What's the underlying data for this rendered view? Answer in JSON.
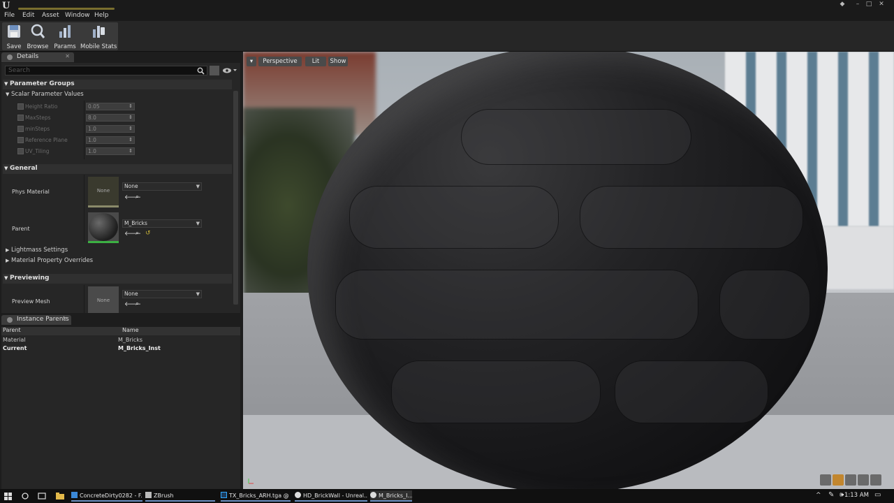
{
  "menu": [
    "File",
    "Edit",
    "Asset",
    "Window",
    "Help"
  ],
  "toolbar": {
    "buttons": [
      {
        "label": "Save",
        "icon": "save-icon"
      },
      {
        "label": "Browse",
        "icon": "browse-icon"
      },
      {
        "label": "Params",
        "icon": "params-icon"
      },
      {
        "label": "Mobile Stats",
        "icon": "mobile-stats-icon"
      }
    ]
  },
  "details": {
    "tab_label": "Details",
    "search_placeholder": "Search",
    "parameter_groups": "Parameter Groups",
    "scalar_parameter_values": "Scalar Parameter Values",
    "scalar_params": [
      {
        "name": "Height Ratio",
        "value": "0.05"
      },
      {
        "name": "MaxSteps",
        "value": "8.0"
      },
      {
        "name": "minSteps",
        "value": "1.0"
      },
      {
        "name": "Reference Plane",
        "value": "1.0"
      },
      {
        "name": "UV_Tiling",
        "value": "1.0"
      }
    ],
    "general": "General",
    "phys_material_label": "Phys Material",
    "phys_material_thumb": "None",
    "phys_material_value": "None",
    "parent_label": "Parent",
    "parent_value": "M_Bricks",
    "lightmass_settings": "Lightmass Settings",
    "material_property_overrides": "Material Property Overrides",
    "previewing": "Previewing",
    "preview_mesh_label": "Preview Mesh",
    "preview_mesh_thumb": "None",
    "preview_mesh_value": "None"
  },
  "instance_parents": {
    "tab_label": "Instance Parents",
    "col_parent": "Parent",
    "col_name": "Name",
    "rows": [
      {
        "parent": "Material",
        "name": "M_Bricks"
      },
      {
        "parent": "Current",
        "name": "M_Bricks_Inst"
      }
    ]
  },
  "viewport": {
    "perspective": "Perspective",
    "lit": "Lit",
    "show": "Show"
  },
  "taskbar": {
    "items": [
      "ConcreteDirty0282 - F...",
      "ZBrush",
      "TX_Bricks_ARH.tga @ ...",
      "HD_BrickWall - Unreal...",
      "M_Bricks_I..."
    ],
    "time": "1:13 AM"
  },
  "colors": {
    "accent_green": "#3cb043",
    "panel_bg": "#262626",
    "taskbar_underline": "#6a8ec0"
  }
}
